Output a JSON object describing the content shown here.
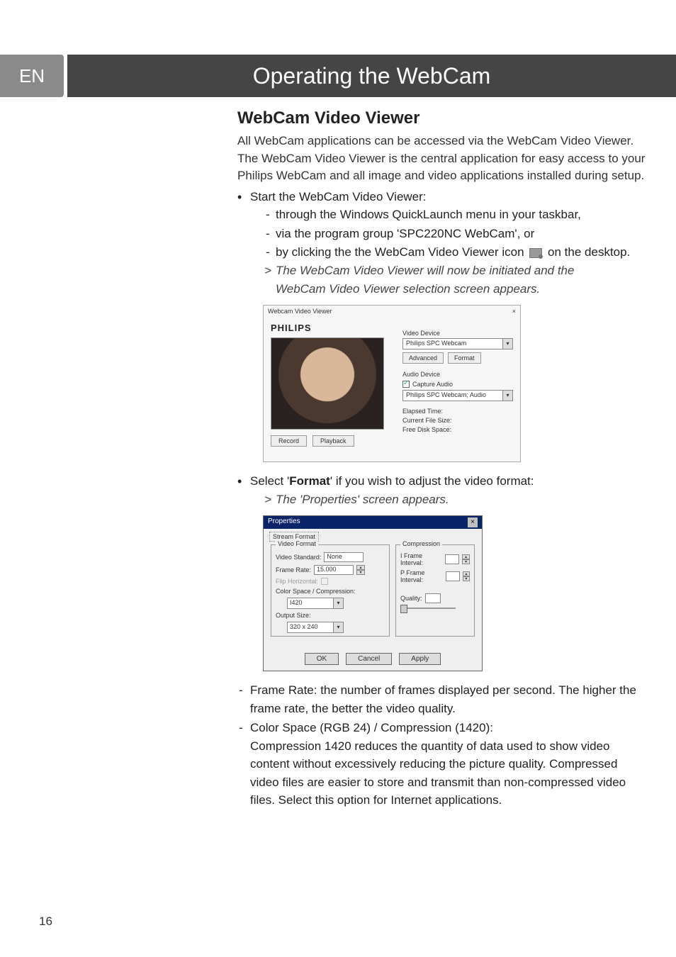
{
  "sideTab": "EN",
  "chapterTitle": "Operating the WebCam",
  "section": {
    "heading": "WebCam Video Viewer",
    "intro": "All WebCam applications can be accessed via the WebCam Video Viewer. The WebCam Video Viewer is the central application for easy access to your Philips WebCam and all image and video applications installed during setup.",
    "startLine": "Start the WebCam Video Viewer:",
    "sub1": "through the Windows QuickLaunch menu in your taskbar,",
    "sub2": "via the program group 'SPC220NC WebCam', or",
    "sub3a": "by clicking the the WebCam Video Viewer icon",
    "sub3b": "on the desktop.",
    "gt1a": "The WebCam Video Viewer will now be initiated and the",
    "gt1b": "WebCam Video Viewer selection screen appears."
  },
  "viewerShot": {
    "title": "Webcam Video Viewer",
    "close": "×",
    "brand": "PHILIPS",
    "record": "Record",
    "playback": "Playback",
    "videoDeviceLabel": "Video Device",
    "videoDevice": "Philips SPC Webcam",
    "advanced": "Advanced",
    "format": "Format",
    "audioDeviceLabel": "Audio Device",
    "captureAudio": "Capture Audio",
    "audioDevice": "Philips SPC Webcam; Audio",
    "stat1": "Elapsed Time:",
    "stat2": "Current File Size:",
    "stat3": "Free Disk Space:"
  },
  "formatBullet": {
    "pre": "Select '",
    "bold": "Format",
    "post": "' if you wish to adjust the video format:",
    "gt": "The 'Properties' screen appears."
  },
  "propsShot": {
    "title": "Properties",
    "x": "×",
    "tab": "Stream Format",
    "vfTitle": "Video Format",
    "cpTitle": "Compression",
    "videoStandardLabel": "Video Standard:",
    "videoStandard": "None",
    "frameRateLabel": "Frame Rate:",
    "frameRate": "15.000",
    "flip": "Flip Horizontal:",
    "colorLabel": "Color Space / Compression:",
    "color": "I420",
    "outputLabel": "Output Size:",
    "output": "320 x 240",
    "iframe": "I Frame Interval:",
    "pframe": "P Frame Interval:",
    "quality": "Quality:",
    "ok": "OK",
    "cancel": "Cancel",
    "apply": "Apply"
  },
  "afterProps": {
    "frLabel": "Frame Rate:",
    "frText": " the number of frames displayed per second. The higher the frame rate, the better the video quality.",
    "csLabel": "Color Space (RGB 24) / Compression (1420):",
    "compLabel": "Compression 1420",
    "compText": " reduces the quantity of data used to show video content without excessively reducing the picture quality. Compressed video files are easier to store and transmit than non-compressed video files. Select this option for Internet applications."
  },
  "pageNumber": "16"
}
